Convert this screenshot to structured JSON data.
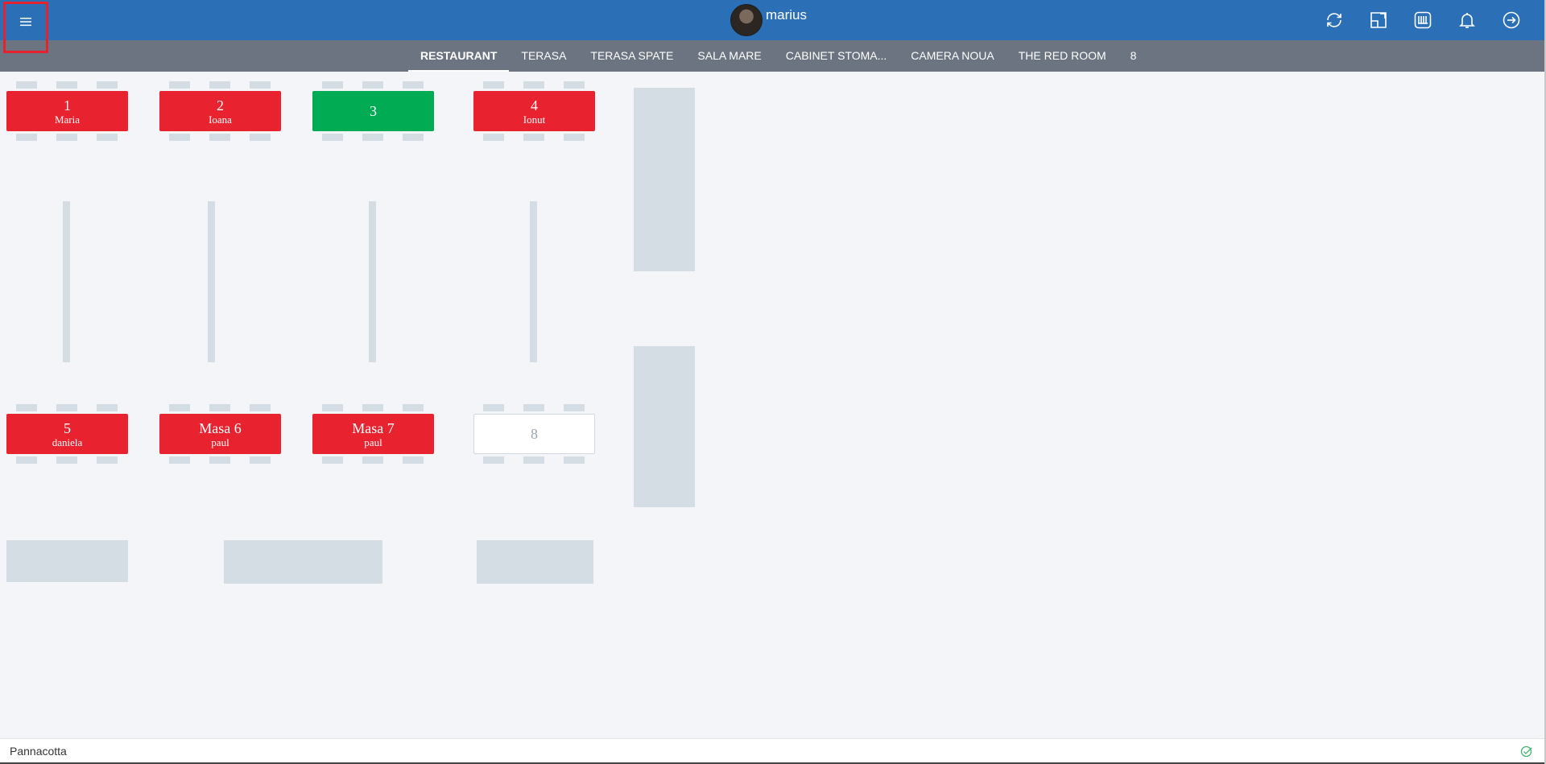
{
  "header": {
    "username": "marius"
  },
  "tabs": [
    {
      "label": "RESTAURANT",
      "active": true
    },
    {
      "label": "TERASA"
    },
    {
      "label": "TERASA SPATE"
    },
    {
      "label": "SALA MARE"
    },
    {
      "label": "CABINET STOMA..."
    },
    {
      "label": "CAMERA NOUA"
    },
    {
      "label": "THE RED ROOM"
    },
    {
      "label": "8"
    }
  ],
  "tables": [
    {
      "name": "1",
      "guest": "Maria",
      "status": "busy"
    },
    {
      "name": "2",
      "guest": "Ioana",
      "status": "busy"
    },
    {
      "name": "3",
      "guest": "",
      "status": "free"
    },
    {
      "name": "4",
      "guest": "Ionut",
      "status": "busy"
    },
    {
      "name": "5",
      "guest": "daniela",
      "status": "busy"
    },
    {
      "name": "Masa 6",
      "guest": "paul",
      "status": "busy"
    },
    {
      "name": "Masa 7",
      "guest": "paul",
      "status": "busy"
    },
    {
      "name": "8",
      "guest": "",
      "status": "empty"
    }
  ],
  "status_bar": {
    "text": "Pannacotta"
  },
  "colors": {
    "header": "#2b6fb6",
    "tabbar": "#6b7480",
    "busy": "#e8232f",
    "free": "#00ab53",
    "decor": "#d3dde3"
  },
  "icons": [
    "menu-icon",
    "refresh-icon",
    "fullscreen-icon",
    "cash-register-icon",
    "bell-icon",
    "logout-icon",
    "check-icon"
  ]
}
